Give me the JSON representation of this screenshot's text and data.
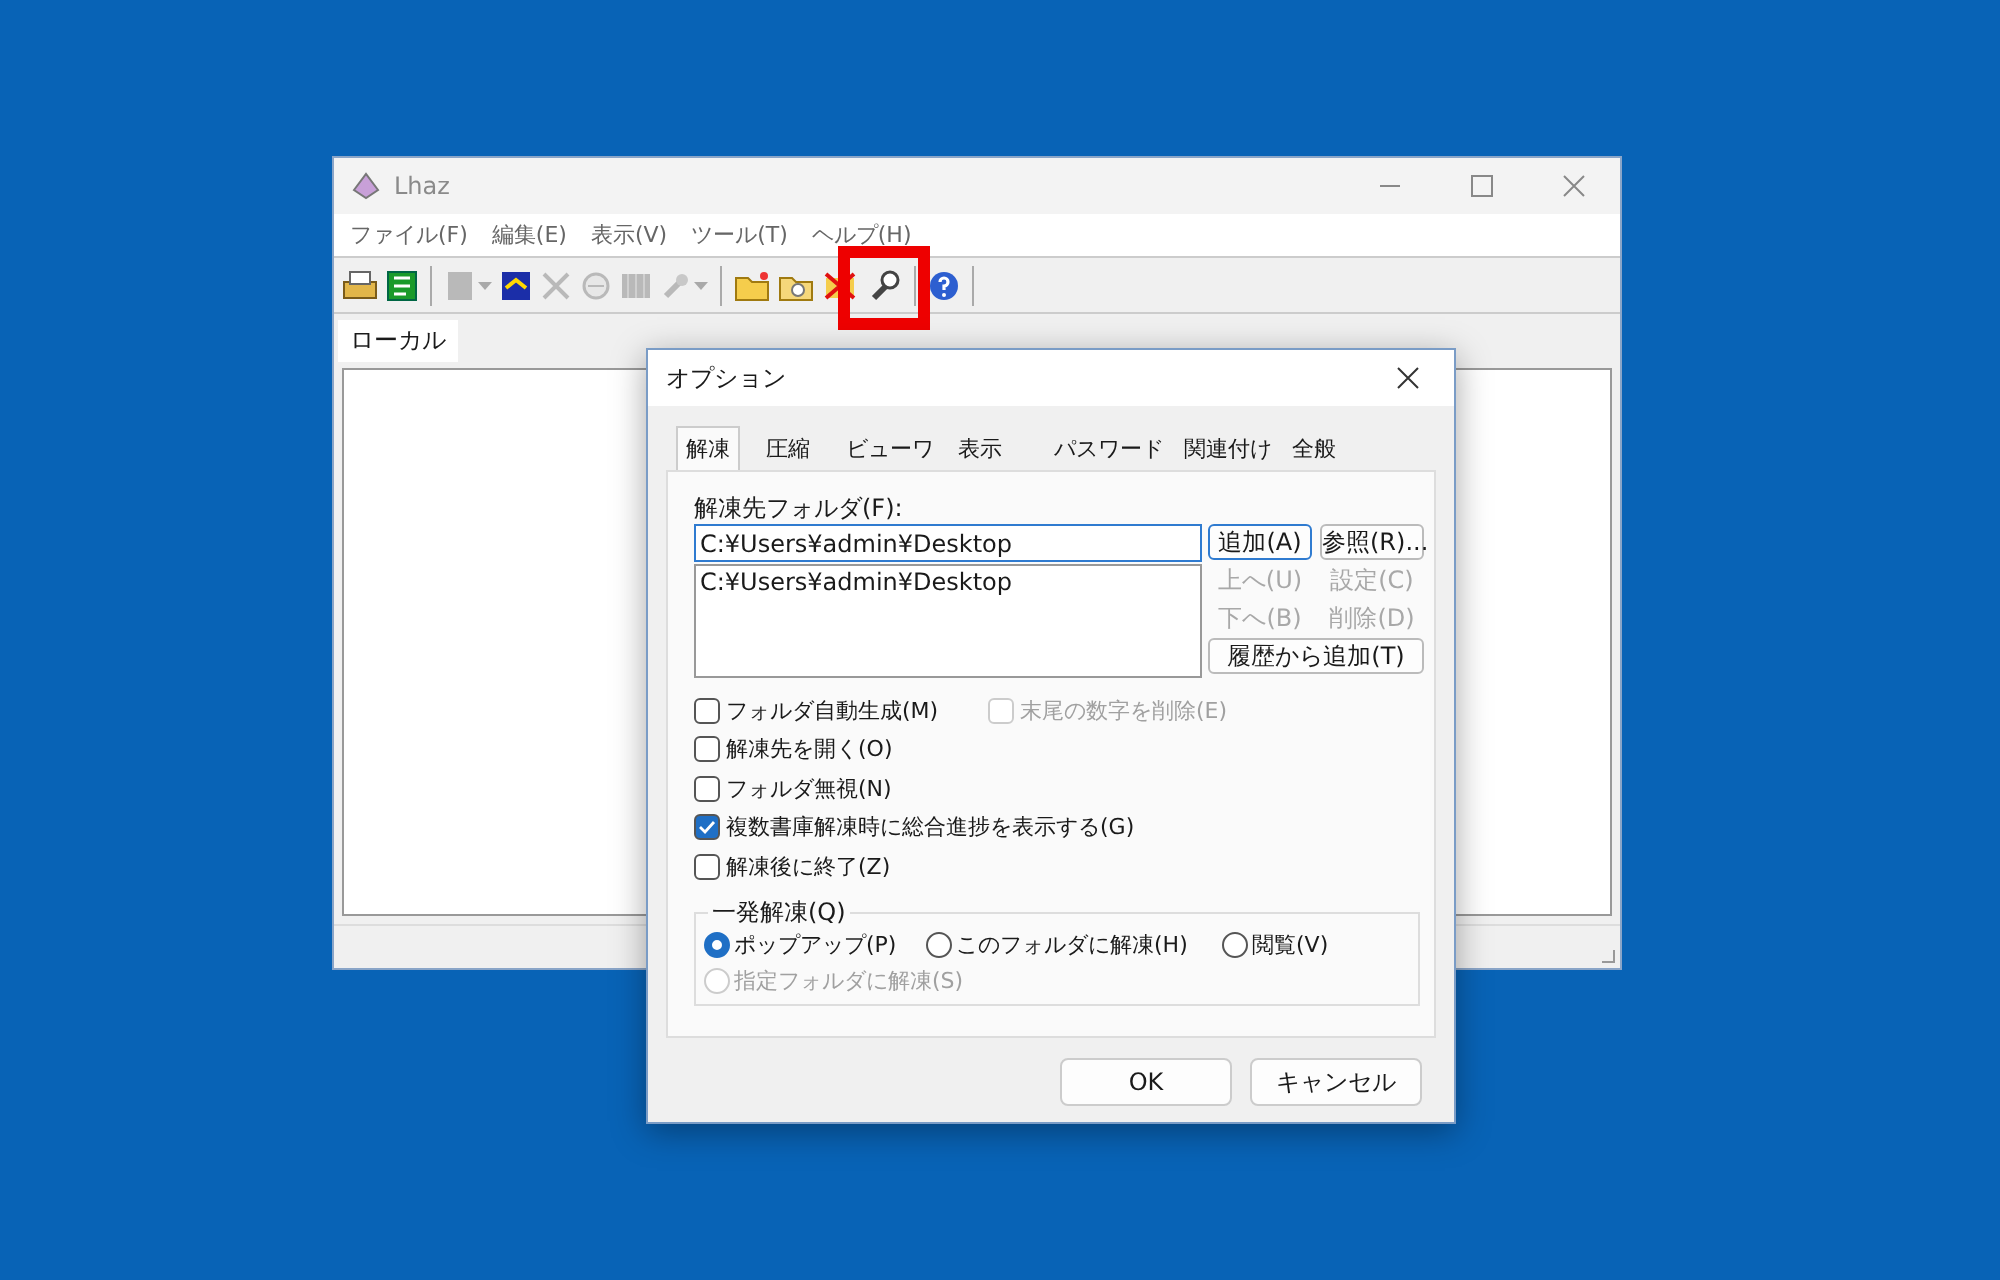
{
  "main_window": {
    "title": "Lhaz",
    "menu": [
      "ファイル(F)",
      "編集(E)",
      "表示(V)",
      "ツール(T)",
      "ヘルプ(H)"
    ],
    "toolbar_groups": [
      [
        {
          "disabled": false,
          "has_menu": false,
          "highlighted": false
        },
        {
          "disabled": false,
          "has_menu": false,
          "highlighted": false
        }
      ],
      [
        {
          "disabled": true,
          "has_menu": true,
          "highlighted": false
        },
        {
          "disabled": false,
          "has_menu": false,
          "highlighted": false
        },
        {
          "disabled": true,
          "has_menu": false,
          "highlighted": false
        },
        {
          "disabled": true,
          "has_menu": false,
          "highlighted": false
        },
        {
          "disabled": true,
          "has_menu": false,
          "highlighted": false
        },
        {
          "disabled": true,
          "has_menu": true,
          "highlighted": false
        }
      ],
      [
        {
          "disabled": false,
          "has_menu": false,
          "highlighted": false
        },
        {
          "disabled": false,
          "has_menu": false,
          "highlighted": false
        },
        {
          "disabled": false,
          "has_menu": false,
          "highlighted": false
        },
        {
          "disabled": false,
          "has_menu": false,
          "highlighted": true
        }
      ],
      [
        {
          "disabled": false,
          "has_menu": false,
          "highlighted": false
        }
      ]
    ],
    "tabs": [
      {
        "label": "ローカル",
        "selected": true
      }
    ]
  },
  "dialog": {
    "title": "オプション",
    "tabs": [
      {
        "label": "解凍",
        "selected": true
      },
      {
        "label": "圧縮",
        "selected": false
      },
      {
        "label": "ビューワ",
        "selected": false
      },
      {
        "label": "表示",
        "selected": false
      },
      {
        "label": "パスワード",
        "selected": false
      },
      {
        "label": "関連付け",
        "selected": false
      },
      {
        "label": "全般",
        "selected": false
      }
    ],
    "folder_label": "解凍先フォルダ(F):",
    "folder_value": "C:¥Users¥admin¥Desktop",
    "folder_list": [
      "C:¥Users¥admin¥Desktop"
    ],
    "side_buttons": [
      {
        "label": "追加(A)",
        "disabled": false,
        "focused": true
      },
      {
        "label": "参照(R)...",
        "disabled": false,
        "focused": false
      },
      {
        "label": "上へ(U)",
        "disabled": true,
        "focused": false
      },
      {
        "label": "設定(C)",
        "disabled": true,
        "focused": false
      },
      {
        "label": "下へ(B)",
        "disabled": true,
        "focused": false
      },
      {
        "label": "削除(D)",
        "disabled": true,
        "focused": false
      }
    ],
    "history_button": "履歴から追加(T)",
    "checkbox_rows": [
      [
        {
          "label": "フォルダ自動生成(M)",
          "checked": false,
          "disabled": false
        },
        {
          "label": "末尾の数字を削除(E)",
          "checked": false,
          "disabled": true
        }
      ],
      [
        {
          "label": "解凍先を開く(O)",
          "checked": false,
          "disabled": false
        }
      ],
      [
        {
          "label": "フォルダ無視(N)",
          "checked": false,
          "disabled": false
        }
      ],
      [
        {
          "label": "複数書庫解凍時に総合進捗を表示する(G)",
          "checked": true,
          "disabled": false
        }
      ],
      [
        {
          "label": "解凍後に終了(Z)",
          "checked": false,
          "disabled": false
        }
      ]
    ],
    "group": {
      "label": "一発解凍(Q)",
      "radios": [
        {
          "label": "ポップアップ(P)",
          "selected": true,
          "disabled": false
        },
        {
          "label": "このフォルダに解凍(H)",
          "selected": false,
          "disabled": false
        },
        {
          "label": "閲覧(V)",
          "selected": false,
          "disabled": false
        },
        {
          "label": "指定フォルダに解凍(S)",
          "selected": false,
          "disabled": true
        }
      ]
    },
    "buttons": [
      "OK",
      "キャンセル"
    ]
  }
}
